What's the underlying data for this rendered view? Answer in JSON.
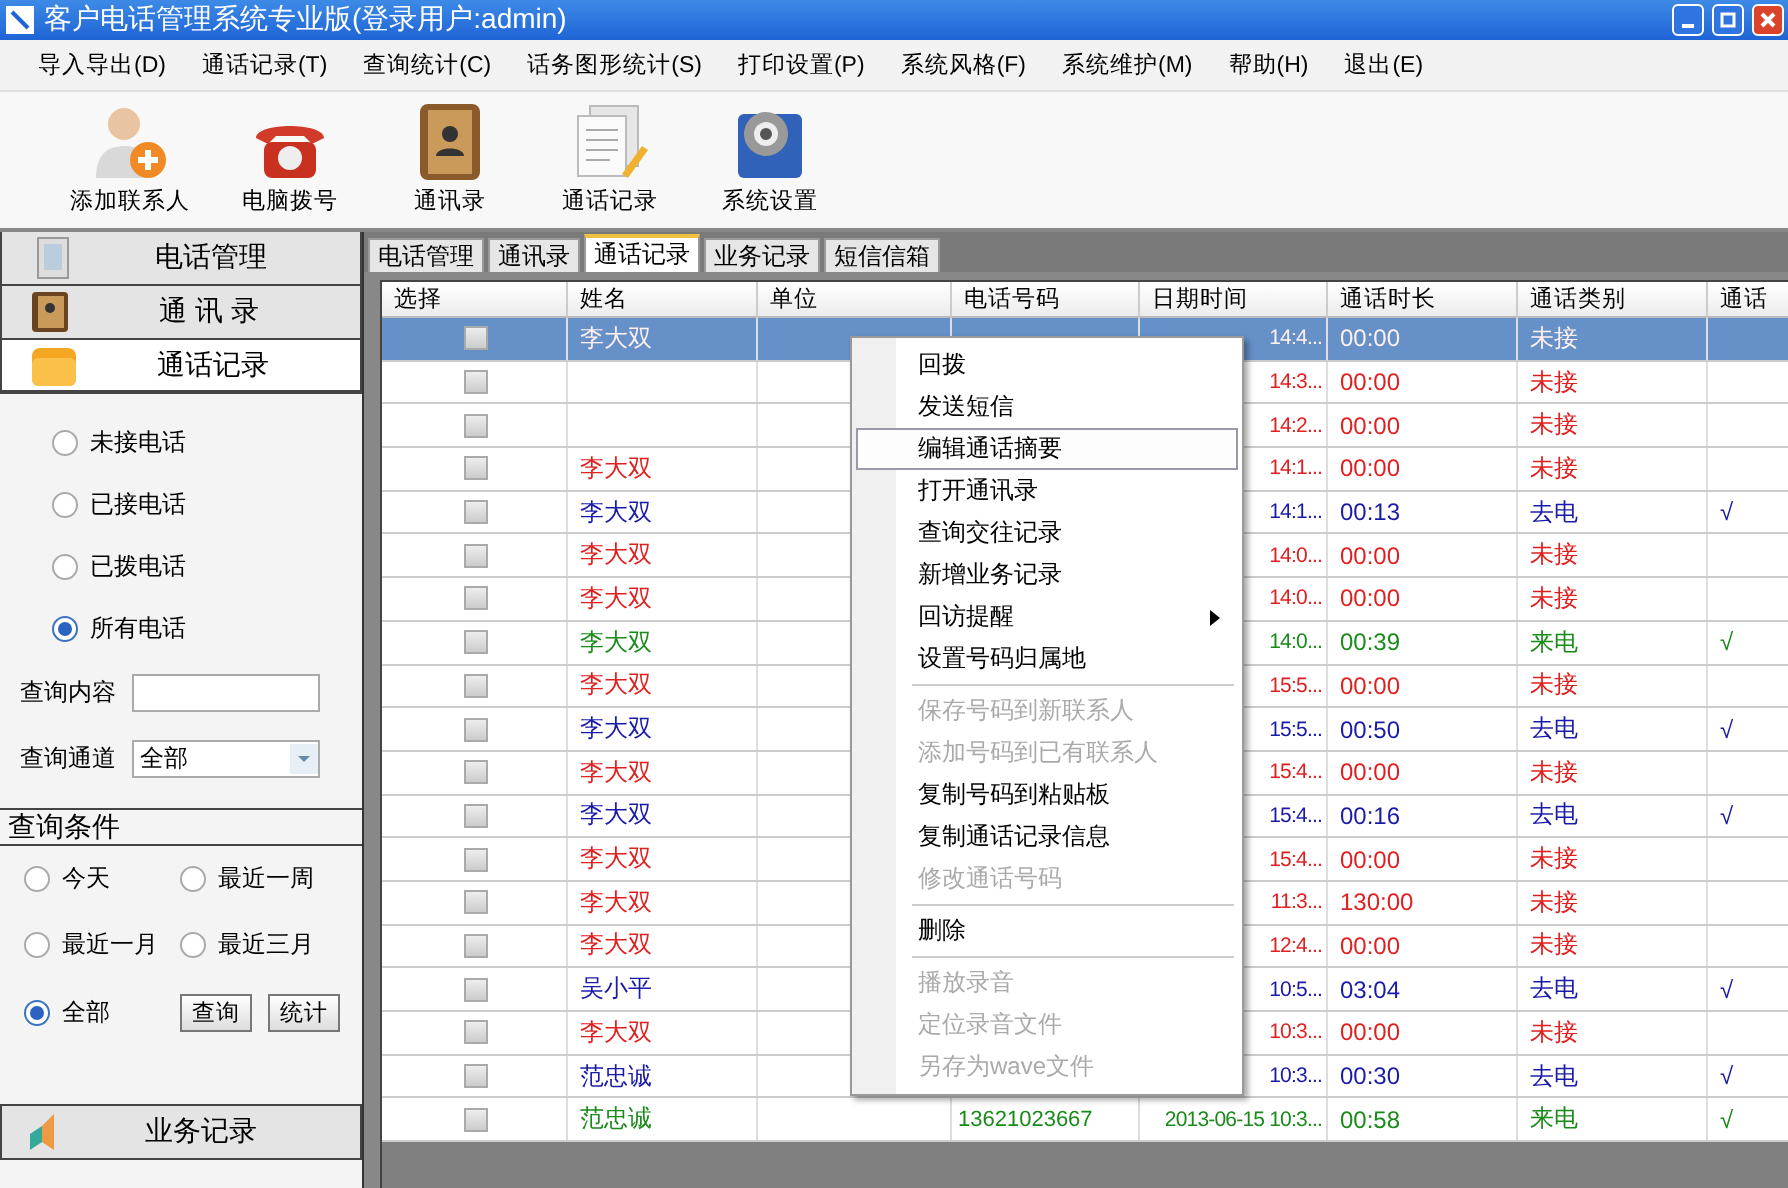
{
  "window": {
    "title": "客户电话管理系统专业版(登录用户:admin)"
  },
  "menu": [
    "导入导出(D)",
    "通话记录(T)",
    "查询统计(C)",
    "话务图形统计(S)",
    "打印设置(P)",
    "系统风格(F)",
    "系统维护(M)",
    "帮助(H)",
    "退出(E)"
  ],
  "toolbar": [
    {
      "kind": "add-contact",
      "label": "添加联系人"
    },
    {
      "kind": "phone",
      "label": "电脑拨号"
    },
    {
      "kind": "book",
      "label": "通讯录"
    },
    {
      "kind": "notes",
      "label": "通话记录"
    },
    {
      "kind": "settings",
      "label": "系统设置"
    }
  ],
  "sidebar": {
    "sections": [
      {
        "kind": "phone",
        "label": "电话管理",
        "expanded": false
      },
      {
        "kind": "book",
        "label": "通 讯 录",
        "expanded": false
      },
      {
        "kind": "folder",
        "label": "通话记录",
        "expanded": true
      }
    ],
    "call_filters": [
      {
        "label": "未接电话",
        "selected": false
      },
      {
        "label": "已接电话",
        "selected": false
      },
      {
        "label": "已拨电话",
        "selected": false
      },
      {
        "label": "所有电话",
        "selected": true
      }
    ],
    "query_content": {
      "label": "查询内容"
    },
    "query_channel": {
      "label": "查询通道",
      "value": "全部"
    },
    "conditions": {
      "title": "查询条件",
      "options": [
        {
          "label": "今天",
          "selected": false
        },
        {
          "label": "最近一周",
          "selected": false
        },
        {
          "label": "最近一月",
          "selected": false
        },
        {
          "label": "最近三月",
          "selected": false
        },
        {
          "label": "全部",
          "selected": true
        }
      ],
      "buttons": [
        "查询",
        "统计"
      ]
    },
    "bottom_section": {
      "kind": "chart",
      "label": "业务记录"
    }
  },
  "tabs": [
    {
      "label": "电话管理",
      "selected": false
    },
    {
      "label": "通讯录",
      "selected": false
    },
    {
      "label": "通话记录",
      "selected": true
    },
    {
      "label": "业务记录",
      "selected": false
    },
    {
      "label": "短信信箱",
      "selected": false
    }
  ],
  "table": {
    "columns": [
      "选择",
      "姓名",
      "单位",
      "电话号码",
      "日期时间",
      "通话时长",
      "通话类别",
      "通话"
    ],
    "rows": [
      {
        "kind": "missed",
        "selected": true,
        "checked": false,
        "name": "李大双",
        "datetime": "14:4...",
        "duration": "00:00",
        "type": "未接"
      },
      {
        "kind": "missed",
        "selected": false,
        "checked": false,
        "datetime": "14:3...",
        "duration": "00:00",
        "type": "未接"
      },
      {
        "kind": "missed",
        "selected": false,
        "checked": false,
        "datetime": "14:2...",
        "duration": "00:00",
        "type": "未接"
      },
      {
        "kind": "missed",
        "selected": false,
        "checked": false,
        "name": "李大双",
        "datetime": "14:1...",
        "duration": "00:00",
        "type": "未接"
      },
      {
        "kind": "outgoing",
        "selected": false,
        "checked": false,
        "name": "李大双",
        "datetime": "14:1...",
        "duration": "00:13",
        "type": "去电",
        "record": "√"
      },
      {
        "kind": "missed",
        "selected": false,
        "checked": false,
        "name": "李大双",
        "datetime": "14:0...",
        "duration": "00:00",
        "type": "未接"
      },
      {
        "kind": "missed",
        "selected": false,
        "checked": false,
        "name": "李大双",
        "datetime": "14:0...",
        "duration": "00:00",
        "type": "未接"
      },
      {
        "kind": "incoming",
        "selected": false,
        "checked": false,
        "name": "李大双",
        "datetime": "14:0...",
        "duration": "00:39",
        "type": "来电",
        "record": "√"
      },
      {
        "kind": "missed",
        "selected": false,
        "checked": false,
        "name": "李大双",
        "datetime": "15:5...",
        "duration": "00:00",
        "type": "未接"
      },
      {
        "kind": "outgoing",
        "selected": false,
        "checked": false,
        "name": "李大双",
        "datetime": "15:5...",
        "duration": "00:50",
        "type": "去电",
        "record": "√"
      },
      {
        "kind": "missed",
        "selected": false,
        "checked": false,
        "name": "李大双",
        "datetime": "15:4...",
        "duration": "00:00",
        "type": "未接"
      },
      {
        "kind": "outgoing",
        "selected": false,
        "checked": false,
        "name": "李大双",
        "datetime": "15:4...",
        "duration": "00:16",
        "type": "去电",
        "record": "√"
      },
      {
        "kind": "missed",
        "selected": false,
        "checked": false,
        "name": "李大双",
        "datetime": "15:4...",
        "duration": "00:00",
        "type": "未接"
      },
      {
        "kind": "missed",
        "selected": false,
        "checked": false,
        "name": "李大双",
        "datetime": "11:3...",
        "duration": "130:00",
        "type": "未接"
      },
      {
        "kind": "missed",
        "selected": false,
        "checked": false,
        "name": "李大双",
        "datetime": "12:4...",
        "duration": "00:00",
        "type": "未接"
      },
      {
        "kind": "outgoing",
        "selected": false,
        "checked": false,
        "name": "吴小平",
        "datetime": "10:5...",
        "duration": "03:04",
        "type": "去电",
        "record": "√"
      },
      {
        "kind": "missed",
        "selected": false,
        "checked": false,
        "name": "李大双",
        "datetime": "10:3...",
        "duration": "00:00",
        "type": "未接"
      },
      {
        "kind": "outgoing",
        "selected": false,
        "checked": false,
        "name": "范忠诚",
        "datetime": "10:3...",
        "duration": "00:30",
        "type": "去电",
        "record": "√"
      },
      {
        "kind": "incoming",
        "selected": false,
        "checked": false,
        "name": "范忠诚",
        "phone": "13621023667",
        "datetime": "2013-06-15 10:3...",
        "duration": "00:58",
        "type": "来电",
        "record": "√"
      }
    ]
  },
  "context_menu": {
    "items": [
      {
        "kind": "item",
        "label": "回拨",
        "disabled": false,
        "selected": false
      },
      {
        "kind": "item",
        "label": "发送短信",
        "disabled": false,
        "selected": false
      },
      {
        "kind": "item",
        "label": "编辑通话摘要",
        "disabled": false,
        "selected": true
      },
      {
        "kind": "item",
        "label": "打开通讯录",
        "disabled": false,
        "selected": false
      },
      {
        "kind": "item",
        "label": "查询交往记录",
        "disabled": false,
        "selected": false
      },
      {
        "kind": "item",
        "label": "新增业务记录",
        "disabled": false,
        "selected": false
      },
      {
        "kind": "item",
        "label": "回访提醒",
        "disabled": false,
        "selected": false,
        "submenu": true
      },
      {
        "kind": "item",
        "label": "设置号码归属地",
        "disabled": false,
        "selected": false
      },
      {
        "kind": "separator"
      },
      {
        "kind": "item",
        "label": "保存号码到新联系人",
        "disabled": true,
        "selected": false
      },
      {
        "kind": "item",
        "label": "添加号码到已有联系人",
        "disabled": true,
        "selected": false
      },
      {
        "kind": "item",
        "label": "复制号码到粘贴板",
        "disabled": false,
        "selected": false
      },
      {
        "kind": "item",
        "label": "复制通话记录信息",
        "disabled": false,
        "selected": false
      },
      {
        "kind": "item",
        "label": "修改通话号码",
        "disabled": true,
        "selected": false
      },
      {
        "kind": "separator"
      },
      {
        "kind": "item",
        "label": "删除",
        "disabled": false,
        "selected": false
      },
      {
        "kind": "separator"
      },
      {
        "kind": "item",
        "label": "播放录音",
        "disabled": true,
        "selected": false
      },
      {
        "kind": "item",
        "label": "定位录音文件",
        "disabled": true,
        "selected": false
      },
      {
        "kind": "item",
        "label": "另存为wave文件",
        "disabled": true,
        "selected": false
      }
    ]
  }
}
